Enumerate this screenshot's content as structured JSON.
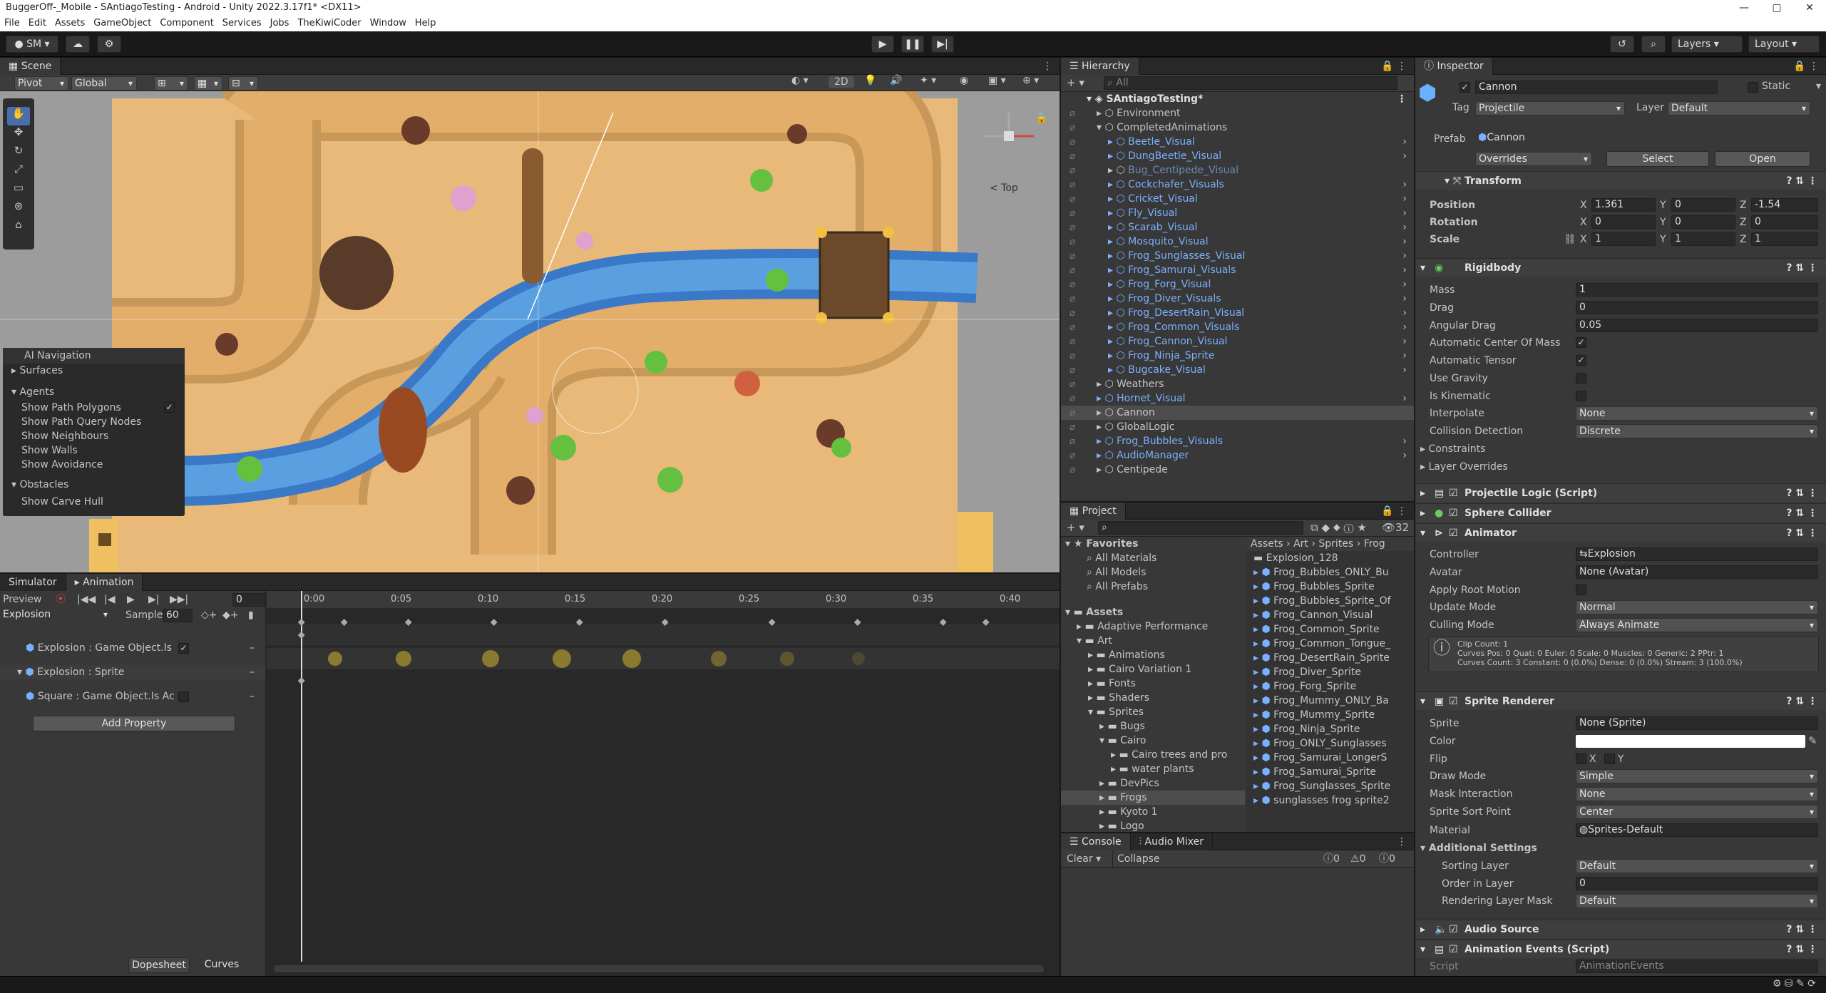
{
  "window": {
    "title": "BuggerOff-_Mobile - SAntiagoTesting - Android - Unity 2022.3.17f1* <DX11>",
    "min": "—",
    "max": "▢",
    "close": "✕"
  },
  "menu": [
    "File",
    "Edit",
    "Assets",
    "GameObject",
    "Component",
    "Services",
    "Jobs",
    "TheKiwiCoder",
    "Window",
    "Help"
  ],
  "toolbar": {
    "account": "SM",
    "layers": "Layers",
    "layout": "Layout"
  },
  "scene": {
    "tab": "Scene",
    "pivot": "Pivot",
    "global": "Global",
    "mode2d": "2D",
    "top_label": "< Top"
  },
  "ai_nav": {
    "title": "AI Navigation",
    "surfaces": "Surfaces",
    "agents": "Agents",
    "items": [
      "Show Path Polygons",
      "Show Path Query Nodes",
      "Show Neighbours",
      "Show Walls",
      "Show Avoidance"
    ],
    "obstacles": "Obstacles",
    "carve": "Show Carve Hull"
  },
  "animation": {
    "tab_sim": "Simulator",
    "tab_anim": "Animation",
    "preview": "Preview",
    "frame": "0",
    "clip": "Explosion",
    "samples_label": "Samples",
    "samples": "60",
    "times": [
      "0:00",
      "0:05",
      "0:10",
      "0:15",
      "0:20",
      "0:25",
      "0:30",
      "0:35",
      "0:40"
    ],
    "props": [
      "Explosion : Game Object.Is",
      "Explosion : Sprite",
      "Square : Game Object.Is Ac"
    ],
    "add_property": "Add Property",
    "dopesheet": "Dopesheet",
    "curves": "Curves"
  },
  "hierarchy": {
    "tab": "Hierarchy",
    "search": "All",
    "scene": "SAntiagoTesting*",
    "items": [
      {
        "t": "Environment",
        "d": 1,
        "c": "n"
      },
      {
        "t": "CompletedAnimations",
        "d": 1,
        "c": "n"
      },
      {
        "t": "Beetle_Visual",
        "d": 2,
        "c": "b"
      },
      {
        "t": "DungBeetle_Visual",
        "d": 2,
        "c": "b"
      },
      {
        "t": "Bug_Centipede_Visual",
        "d": 2,
        "c": "d"
      },
      {
        "t": "Cockchafer_Visuals",
        "d": 2,
        "c": "b"
      },
      {
        "t": "Cricket_Visual",
        "d": 2,
        "c": "b"
      },
      {
        "t": "Fly_Visual",
        "d": 2,
        "c": "b"
      },
      {
        "t": "Scarab_Visual",
        "d": 2,
        "c": "b"
      },
      {
        "t": "Mosquito_Visual",
        "d": 2,
        "c": "b"
      },
      {
        "t": "Frog_Sunglasses_Visual",
        "d": 2,
        "c": "b"
      },
      {
        "t": "Frog_Samurai_Visuals",
        "d": 2,
        "c": "b"
      },
      {
        "t": "Frog_Forg_Visual",
        "d": 2,
        "c": "b"
      },
      {
        "t": "Frog_Diver_Visuals",
        "d": 2,
        "c": "b"
      },
      {
        "t": "Frog_DesertRain_Visual",
        "d": 2,
        "c": "b"
      },
      {
        "t": "Frog_Common_Visuals",
        "d": 2,
        "c": "b"
      },
      {
        "t": "Frog_Cannon_Visual",
        "d": 2,
        "c": "b"
      },
      {
        "t": "Frog_Ninja_Sprite",
        "d": 2,
        "c": "b"
      },
      {
        "t": "Bugcake_Visual",
        "d": 2,
        "c": "b"
      },
      {
        "t": "Weathers",
        "d": 1,
        "c": "n"
      },
      {
        "t": "Hornet_Visual",
        "d": 1,
        "c": "b"
      },
      {
        "t": "Cannon",
        "d": 1,
        "c": "n"
      },
      {
        "t": "GlobalLogic",
        "d": 1,
        "c": "n"
      },
      {
        "t": "Frog_Bubbles_Visuals",
        "d": 1,
        "c": "b"
      },
      {
        "t": "AudioManager",
        "d": 1,
        "c": "b"
      },
      {
        "t": "Centipede",
        "d": 1,
        "c": "n"
      }
    ]
  },
  "project": {
    "tab": "Project",
    "count": "32",
    "breadcrumb": [
      "Assets",
      "Art",
      "Sprites",
      "Frog"
    ],
    "favorites": "Favorites",
    "fav_items": [
      "All Materials",
      "All Models",
      "All Prefabs"
    ],
    "tree": [
      {
        "t": "Assets",
        "d": 0
      },
      {
        "t": "Adaptive Performance",
        "d": 1
      },
      {
        "t": "Art",
        "d": 1
      },
      {
        "t": "Animations",
        "d": 2
      },
      {
        "t": "Cairo Variation 1",
        "d": 2
      },
      {
        "t": "Fonts",
        "d": 2
      },
      {
        "t": "Shaders",
        "d": 2
      },
      {
        "t": "Sprites",
        "d": 2
      },
      {
        "t": "Bugs",
        "d": 3
      },
      {
        "t": "Cairo",
        "d": 3
      },
      {
        "t": "Cairo trees and pro",
        "d": 4
      },
      {
        "t": "water plants",
        "d": 4
      },
      {
        "t": "DevPics",
        "d": 3
      },
      {
        "t": "Frogs",
        "d": 3
      },
      {
        "t": "Kyoto 1",
        "d": 3
      },
      {
        "t": "Logo",
        "d": 3
      }
    ],
    "files": [
      "Explosion_128",
      "Frog_Bubbles_ONLY_Bu",
      "Frog_Bubbles_Sprite",
      "Frog_Bubbles_Sprite_Of",
      "Frog_Cannon_Visual",
      "Frog_Common_Sprite",
      "Frog_Common_Tongue_",
      "Frog_DesertRain_Sprite",
      "Frog_Diver_Sprite",
      "Frog_Forg_Sprite",
      "Frog_Mummy_ONLY_Ba",
      "Frog_Mummy_Sprite",
      "Frog_Ninja_Sprite",
      "Frog_ONLY_Sunglasses",
      "Frog_Samurai_LongerS",
      "Frog_Samurai_Sprite",
      "Frog_Sunglasses_Sprite",
      "sunglasses frog sprite2"
    ]
  },
  "console": {
    "tab": "Console",
    "tab2": "Audio Mixer",
    "clear": "Clear",
    "collapse": "Collapse",
    "c1": "0",
    "c2": "0",
    "c3": "0"
  },
  "inspector": {
    "tab": "Inspector",
    "name": "Cannon",
    "static": "Static",
    "tag_label": "Tag",
    "tag": "Projectile",
    "layer_label": "Layer",
    "layer": "Default",
    "prefab_label": "Prefab",
    "prefab": "Cannon",
    "overrides": "Overrides",
    "select": "Select",
    "open": "Open",
    "transform": {
      "title": "Transform",
      "position": "Position",
      "rotation": "Rotation",
      "scale": "Scale",
      "px": "1.361",
      "py": "0",
      "pz": "-1.54",
      "rx": "0",
      "ry": "0",
      "rz": "0",
      "sx": "1",
      "sy": "1",
      "sz": "1"
    },
    "rigidbody": {
      "title": "Rigidbody",
      "rows": [
        [
          "Mass",
          "1"
        ],
        [
          "Drag",
          "0"
        ],
        [
          "Angular Drag",
          "0.05"
        ]
      ],
      "checks": [
        "Automatic Center Of Mass",
        "Automatic Tensor",
        "Use Gravity",
        "Is Kinematic"
      ],
      "interpolate_label": "Interpolate",
      "interpolate": "None",
      "collision_label": "Collision Detection",
      "collision": "Discrete",
      "constraints": "Constraints",
      "layer_overrides": "Layer Overrides"
    },
    "projectile": "Projectile Logic (Script)",
    "sphere": "Sphere Collider",
    "animator": {
      "title": "Animator",
      "controller_label": "Controller",
      "controller": "Explosion",
      "avatar_label": "Avatar",
      "avatar": "None (Avatar)",
      "root_motion": "Apply Root Motion",
      "update_label": "Update Mode",
      "update": "Normal",
      "culling_label": "Culling Mode",
      "culling": "Always Animate",
      "info1": "Clip Count: 1",
      "info2": "Curves Pos: 0 Quat: 0 Euler: 0 Scale: 0 Muscles: 0 Generic: 2 PPtr: 1",
      "info3": "Curves Count: 3 Constant: 0 (0.0%) Dense: 0 (0.0%) Stream: 3 (100.0%)"
    },
    "sprite_renderer": {
      "title": "Sprite Renderer",
      "sprite_label": "Sprite",
      "sprite": "None (Sprite)",
      "color_label": "Color",
      "flip_label": "Flip",
      "flip_x": "X",
      "flip_y": "Y",
      "draw_label": "Draw Mode",
      "draw": "Simple",
      "mask_label": "Mask Interaction",
      "mask": "None",
      "sort_label": "Sprite Sort Point",
      "sort": "Center",
      "material_label": "Material",
      "material": "Sprites-Default",
      "additional": "Additional Settings",
      "sorting_layer_label": "Sorting Layer",
      "sorting_layer": "Default",
      "order_label": "Order in Layer",
      "order": "0",
      "rendering_label": "Rendering Layer Mask",
      "rendering": "Default"
    },
    "audio": "Audio Source",
    "anim_events": "Animation Events (Script)",
    "script_label": "Script",
    "script": "AnimationEvents"
  }
}
